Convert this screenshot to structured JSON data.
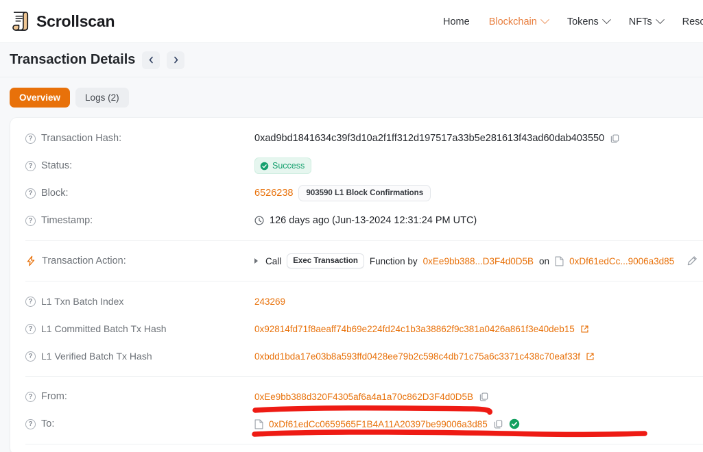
{
  "brand": {
    "name": "Scrollscan",
    "icon": "scroll-icon"
  },
  "nav": {
    "items": [
      {
        "label": "Home",
        "active": false,
        "caret": false
      },
      {
        "label": "Blockchain",
        "active": true,
        "caret": true
      },
      {
        "label": "Tokens",
        "active": false,
        "caret": true
      },
      {
        "label": "NFTs",
        "active": false,
        "caret": true
      },
      {
        "label": "Resou",
        "active": false,
        "caret": false
      }
    ]
  },
  "page": {
    "title": "Transaction Details",
    "prev_icon": "chevron-left-icon",
    "next_icon": "chevron-right-icon"
  },
  "tabs": [
    {
      "label": "Overview",
      "active": true
    },
    {
      "label": "Logs (2)",
      "active": false
    }
  ],
  "details": {
    "tx_hash": {
      "label": "Transaction Hash:",
      "value": "0xad9bd1841634c39f3d10a2f1ff312d197517a33b5e281613f43ad60dab403550",
      "copy_icon": "copy-icon"
    },
    "status": {
      "label": "Status:",
      "value": "Success",
      "icon": "check-circle-icon",
      "color": "#15a06e",
      "bg": "#e6f6ef"
    },
    "block": {
      "label": "Block:",
      "value": "6526238",
      "confirmations": "903590 L1 Block Confirmations"
    },
    "timestamp": {
      "label": "Timestamp:",
      "icon": "clock-icon",
      "value": "126 days ago (Jun-13-2024 12:31:24 PM UTC)"
    },
    "action": {
      "label": "Transaction Action:",
      "icon": "lightning-bolt-icon",
      "call_word": "Call",
      "method": "Exec Transaction",
      "function_by": "Function by",
      "from_addr": "0xEe9bb388...D3F4d0D5B",
      "on_word": "on",
      "to_addr": "0xDf61edCc...9006a3d85",
      "edit_icon": "pencil-icon"
    },
    "l1_batch_index": {
      "label": "L1 Txn Batch Index",
      "value": "243269"
    },
    "l1_committed": {
      "label": "L1 Committed Batch Tx Hash",
      "value": "0x92814fd71f8aeaff74b69e224fd24c1b3a38862f9c381a0426a861f3e40deb15",
      "ext_icon": "external-link-icon"
    },
    "l1_verified": {
      "label": "L1 Verified Batch Tx Hash",
      "value": "0xbdd1bda17e03b8a593ffd0428ee79b2c598c4db71c75a6c3371c438c70eaf33f",
      "ext_icon": "external-link-icon"
    },
    "from": {
      "label": "From:",
      "value": "0xEe9bb388d320F4305af6a4a1a70c862D3F4d0D5B",
      "copy_icon": "copy-icon"
    },
    "to": {
      "label": "To:",
      "value": "0xDf61edCc0659565F1B4A11A20397be99006a3d85",
      "contract_icon": "contract-icon",
      "copy_icon": "copy-icon",
      "verified_icon": "verified-check-icon"
    }
  },
  "annotations": {
    "color": "#ee1b14",
    "marks": [
      {
        "name": "underline-from-address"
      },
      {
        "name": "underline-to-address"
      }
    ]
  },
  "colors": {
    "accent": "#e8710a",
    "link": "#e8710a",
    "page_bg": "#f7f8fa",
    "card_bg": "#ffffff",
    "text": "#23262b",
    "muted": "#6c7177"
  }
}
